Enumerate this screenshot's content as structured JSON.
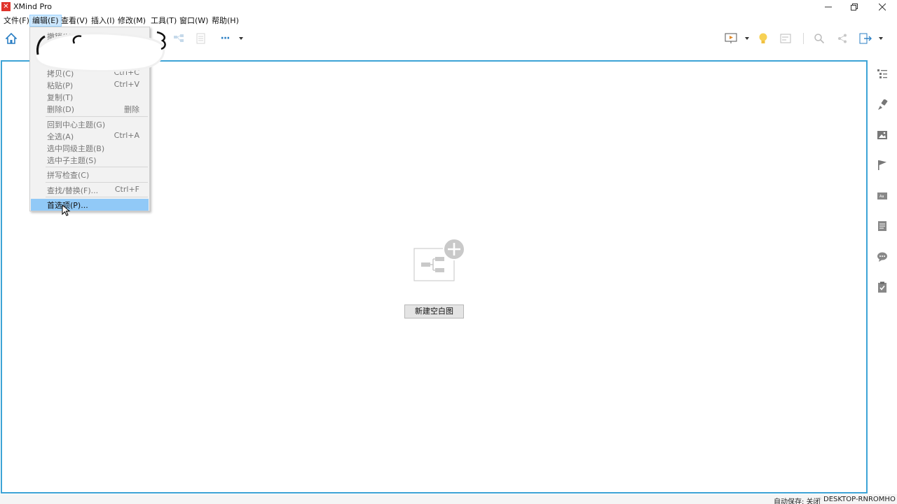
{
  "window": {
    "title": "XMind Pro",
    "logo_glyph": "✕",
    "minimize_icon": "minimize-icon",
    "maximize_icon": "maximize-icon",
    "close_icon": "close-icon"
  },
  "menubar": {
    "items": [
      {
        "label": "文件(F)",
        "active": false
      },
      {
        "label": "编辑(E)",
        "active": true
      },
      {
        "label": "查看(V)",
        "active": false
      },
      {
        "label": "插入(I)",
        "active": false
      },
      {
        "label": "修改(M)",
        "active": false
      },
      {
        "label": "工具(T)",
        "active": false
      },
      {
        "label": "窗口(W)",
        "active": false
      },
      {
        "label": "帮助(H)",
        "active": false
      }
    ]
  },
  "edit_menu": {
    "obscured_label": "撤销(U)",
    "items": [
      {
        "label": "拷贝(C)",
        "shortcut": "Ctrl+C"
      },
      {
        "label": "粘贴(P)",
        "shortcut": "Ctrl+V"
      },
      {
        "label": "复制(T)",
        "shortcut": ""
      },
      {
        "label": "删除(D)",
        "shortcut": "删除"
      },
      {
        "label": "回到中心主题(G)",
        "shortcut": ""
      },
      {
        "label": "全选(A)",
        "shortcut": "Ctrl+A"
      },
      {
        "label": "选中同级主题(B)",
        "shortcut": ""
      },
      {
        "label": "选中子主题(S)",
        "shortcut": ""
      },
      {
        "label": "拼写检查(C)",
        "shortcut": ""
      },
      {
        "label": "查找/替换(F)...",
        "shortcut": "Ctrl+F"
      },
      {
        "label": "首选项(P)...",
        "shortcut": "",
        "highlighted": true
      }
    ]
  },
  "toolbar": {
    "more_glyph": "···"
  },
  "canvas": {
    "new_blank_button": "新建空白图"
  },
  "sidebar": {
    "icons": [
      "outline-icon",
      "format-brush-icon",
      "image-icon",
      "flag-icon",
      "label-icon",
      "notes-icon",
      "comment-icon",
      "task-icon"
    ]
  },
  "statusbar": {
    "autosave": "自动保存: 关闭",
    "dot": "◦",
    "host": "DESKTOP-RNROMHO"
  },
  "colors": {
    "accent_border": "#3da3d6",
    "menu_highlight": "#91c9f7",
    "logo_red": "#e0342b"
  }
}
